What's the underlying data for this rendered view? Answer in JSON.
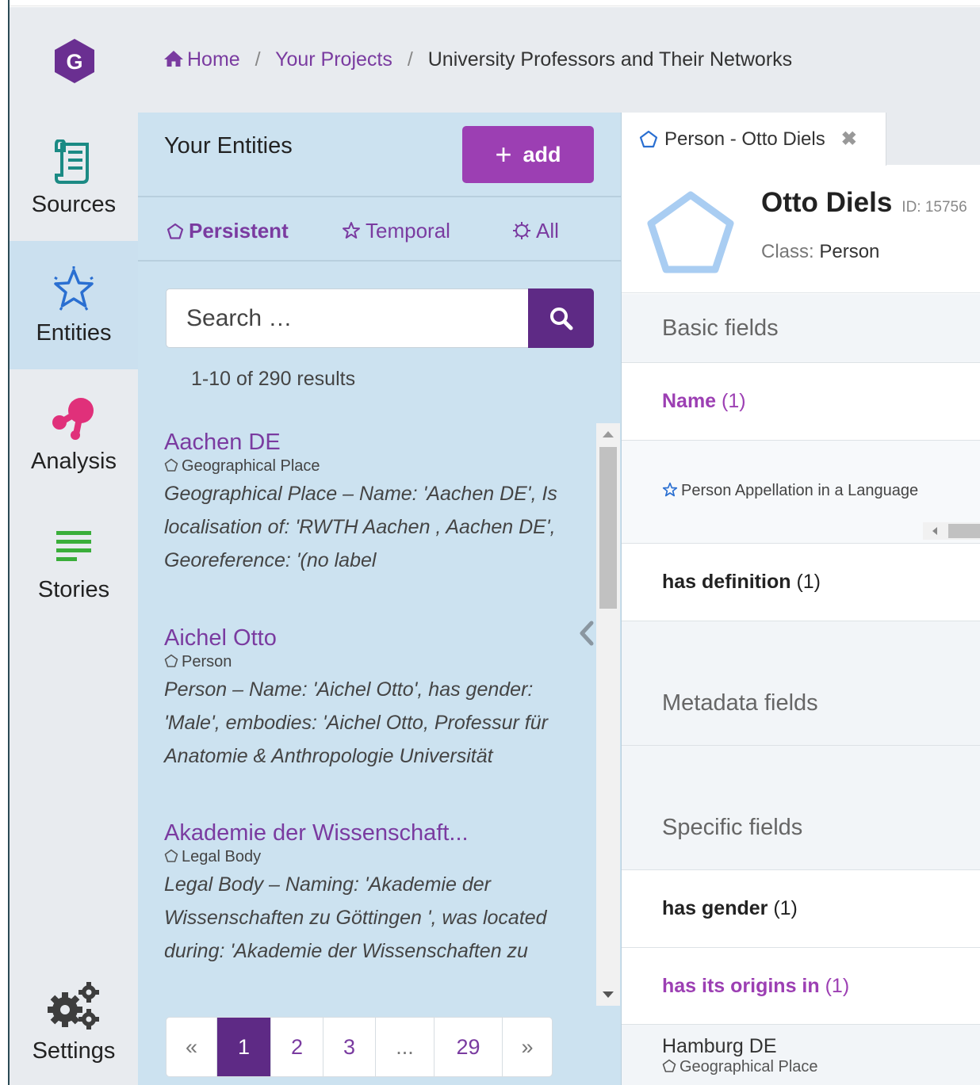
{
  "colors": {
    "accent": "#9c3fb3",
    "primary_dark": "#5e2a85",
    "panel_bg": "#cce2f0",
    "nav_bg": "#e8ebef",
    "persistent_icon": "#9fc6f0"
  },
  "logo": {
    "letter": "G",
    "icon": "hexagon-logo"
  },
  "breadcrumb": {
    "home": "Home",
    "projects": "Your Projects",
    "current": "University Professors and Their Networks",
    "separator": "/"
  },
  "sidebar": {
    "items": [
      {
        "label": "Sources",
        "icon": "scroll-icon",
        "active": false
      },
      {
        "label": "Entities",
        "icon": "star-icon",
        "active": true
      },
      {
        "label": "Analysis",
        "icon": "analysis-icon",
        "active": false
      },
      {
        "label": "Stories",
        "icon": "lines-icon",
        "active": false
      },
      {
        "label": "Settings",
        "icon": "gears-icon",
        "active": false
      }
    ]
  },
  "entities_panel": {
    "title": "Your Entities",
    "add_label": "add",
    "tabs": [
      {
        "label": "Persistent",
        "icon": "pentagon-icon",
        "active": true
      },
      {
        "label": "Temporal",
        "icon": "star-outline-icon",
        "active": false
      },
      {
        "label": "All",
        "icon": "gear-star-icon",
        "active": false
      }
    ],
    "search_placeholder": "Search …",
    "result_count": "1-10 of 290 results",
    "results": [
      {
        "title": "Aachen DE",
        "class": "Geographical Place",
        "desc": "Geographical Place – Name: 'Aachen DE', Is localisation of: 'RWTH Aachen , Aachen DE', Georeference: '(no label"
      },
      {
        "title": "Aichel Otto",
        "class": "Person",
        "desc": "Person – Name: 'Aichel Otto', has gender: 'Male', embodies: 'Aichel Otto, Professur für Anatomie & Anthropologie Universität"
      },
      {
        "title": "Akademie der Wissenschaft...",
        "class": "Legal Body",
        "desc": "Legal Body – Naming: 'Akademie der Wissenschaften zu Göttingen ', was located during: 'Akademie der Wissenschaften zu"
      }
    ],
    "pagination": [
      "«",
      "1",
      "2",
      "3",
      "...",
      "29",
      "»"
    ],
    "current_page": "1"
  },
  "detail": {
    "tab_label": "Person - Otto Diels",
    "tab_close": "✖",
    "name": "Otto Diels",
    "id_text": "ID: 15756",
    "class_label": "Class:",
    "class_value": "Person",
    "basic_fields": "Basic fields",
    "name_field": {
      "label": "Name",
      "count": "(1)"
    },
    "appellation": "Person Appellation in a Language",
    "definition_field": {
      "label": "has definition",
      "count": "(1)"
    },
    "metadata_fields": "Metadata fields",
    "specific_fields": "Specific fields",
    "gender_field": {
      "label": "has gender",
      "count": "(1)"
    },
    "origins_field": {
      "label": "has its origins in",
      "count": "(1)"
    },
    "origin_value": {
      "title": "Hamburg DE",
      "class": "Geographical Place"
    }
  }
}
